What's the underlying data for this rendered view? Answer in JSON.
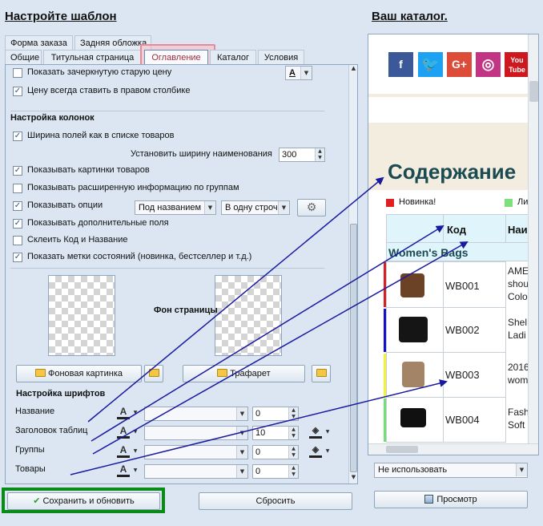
{
  "left_title": "Настройте шаблон",
  "right_title": "Ваш каталог.",
  "tabs_row1": [
    "Форма заказа",
    "Задняя обложка"
  ],
  "tabs_row2": [
    "Общие",
    "Титульная страница",
    "Оглавление",
    "Каталог",
    "Условия"
  ],
  "options": {
    "show_crossed_price": "Показать зачеркнутую старую цену",
    "price_right_column": "Цену всегда ставить в правом столбике",
    "columns_section": "Настройка колонок",
    "field_width_as_list": "Ширина полей как в списке товаров",
    "set_name_width": "Установить ширину наименования",
    "name_width_value": "300",
    "show_product_images": "Показывать картинки товаров",
    "show_group_info": "Показывать расширенную информацию по группам",
    "show_options": "Показывать опции",
    "options_position": "Под названием",
    "options_line": "В одну строчку",
    "show_extra_fields": "Показывать дополнительные поля",
    "merge_code_name": "Склеить Код и Название",
    "show_status_marks": "Показать метки состояний (новинка, бестселлер и т.д.)"
  },
  "background": {
    "label": "Фон страницы",
    "bg_image_button": "Фоновая картинка",
    "stencil_button": "Трафарет"
  },
  "fonts": {
    "section": "Настройка шрифтов",
    "rows": [
      {
        "label": "Название",
        "size": "0"
      },
      {
        "label": "Заголовок таблиц",
        "size": "10"
      },
      {
        "label": "Группы",
        "size": "0"
      },
      {
        "label": "Товары",
        "size": "0"
      }
    ]
  },
  "buttons": {
    "save": "Сохранить и обновить",
    "reset": "Сбросить",
    "preview": "Просмотр",
    "not_used": "Не использовать"
  },
  "catalog": {
    "social_icons": [
      "facebook-icon",
      "twitter-icon",
      "google-plus-icon",
      "instagram-icon",
      "youtube-icon"
    ],
    "google_plus_text": "G+",
    "youtube_text": "You Tube",
    "heading": "Содержание",
    "legend_new": "Новинка!",
    "legend_other": "Ли",
    "col_code": "Код",
    "col_name": "Наи",
    "group": "Women's Bags",
    "rows": [
      {
        "code": "WB001",
        "desc": [
          "AME",
          "shou",
          "Colo"
        ],
        "mark": "#d82020"
      },
      {
        "code": "WB002",
        "desc": [
          "Shel",
          "Ladi"
        ],
        "mark": "#1010c8"
      },
      {
        "code": "WB003",
        "desc": [
          "2016",
          "wom"
        ],
        "mark": "#f2f23a"
      },
      {
        "code": "WB004",
        "desc": [
          "Fash",
          "Soft"
        ],
        "mark": "#70e070"
      }
    ],
    "colors": {
      "heading": "#1b4a52",
      "band": "#f3eddf",
      "group_bg": "#dff5fb",
      "new": "#e02020",
      "other": "#7de07d"
    }
  }
}
